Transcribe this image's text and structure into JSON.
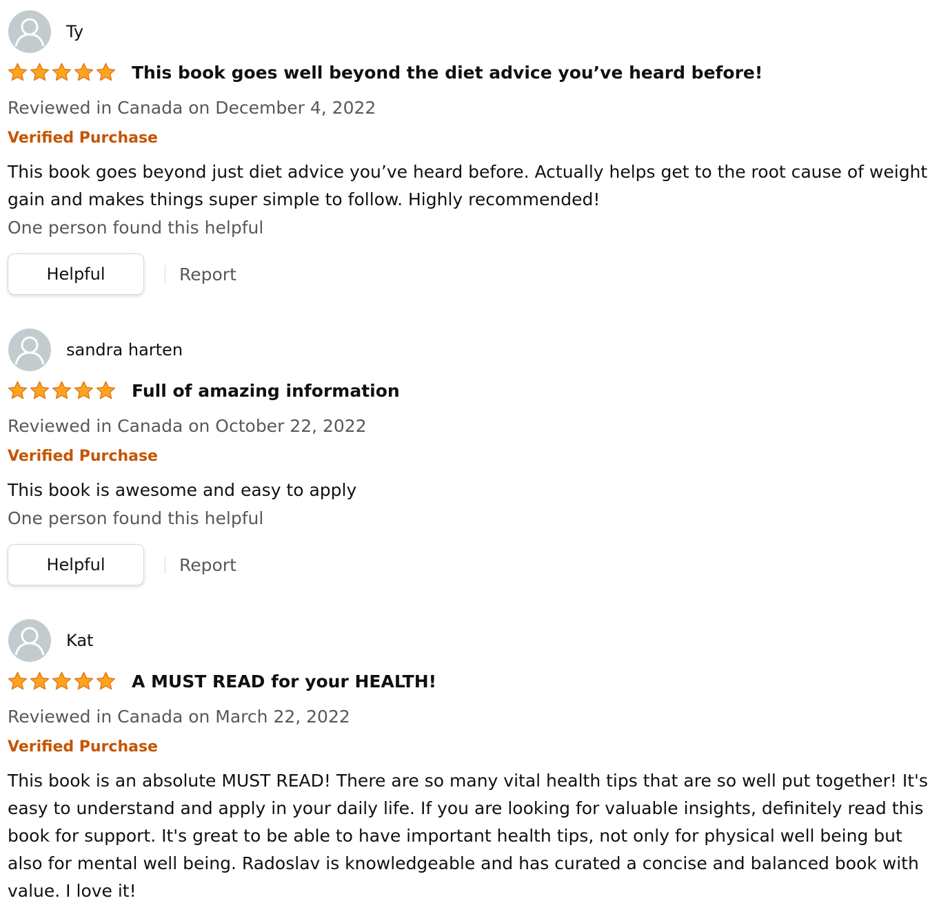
{
  "reviews": [
    {
      "reviewer": "Ty",
      "rating": 5,
      "title": "This book goes well beyond the diet advice you’ve heard before!",
      "date": "Reviewed in Canada on December 4, 2022",
      "verified": "Verified Purchase",
      "body": "This book goes beyond just diet advice you’ve heard before. Actually helps get to the root cause of weight gain and makes things super simple to follow. Highly recommended!",
      "helpful_count": "One person found this helpful",
      "helpful_label": "Helpful",
      "report_label": "Report"
    },
    {
      "reviewer": "sandra harten",
      "rating": 5,
      "title": "Full of amazing information",
      "date": "Reviewed in Canada on October 22, 2022",
      "verified": "Verified Purchase",
      "body": "This book is awesome and easy to apply",
      "helpful_count": "One person found this helpful",
      "helpful_label": "Helpful",
      "report_label": "Report"
    },
    {
      "reviewer": "Kat",
      "rating": 5,
      "title": "A MUST READ for your HEALTH!",
      "date": "Reviewed in Canada on March 22, 2022",
      "verified": "Verified Purchase",
      "body": "This book is an absolute MUST READ! There are so many vital health tips that are so well put together! It's easy to understand and apply in your daily life. If you are looking for valuable insights, definitely read this book for support. It's great to be able to have important health tips, not only for physical well being but also for mental well being. Radoslav is knowledgeable and has curated a concise and balanced book with value. I love it!"
    }
  ],
  "colors": {
    "star": "#ffa41c",
    "star_stroke": "#de7921",
    "verified": "#c45500",
    "muted_text": "#565959",
    "avatar_bg": "#c3cbcf"
  },
  "icons": {
    "avatar": "default-user-icon",
    "star": "star-icon"
  }
}
